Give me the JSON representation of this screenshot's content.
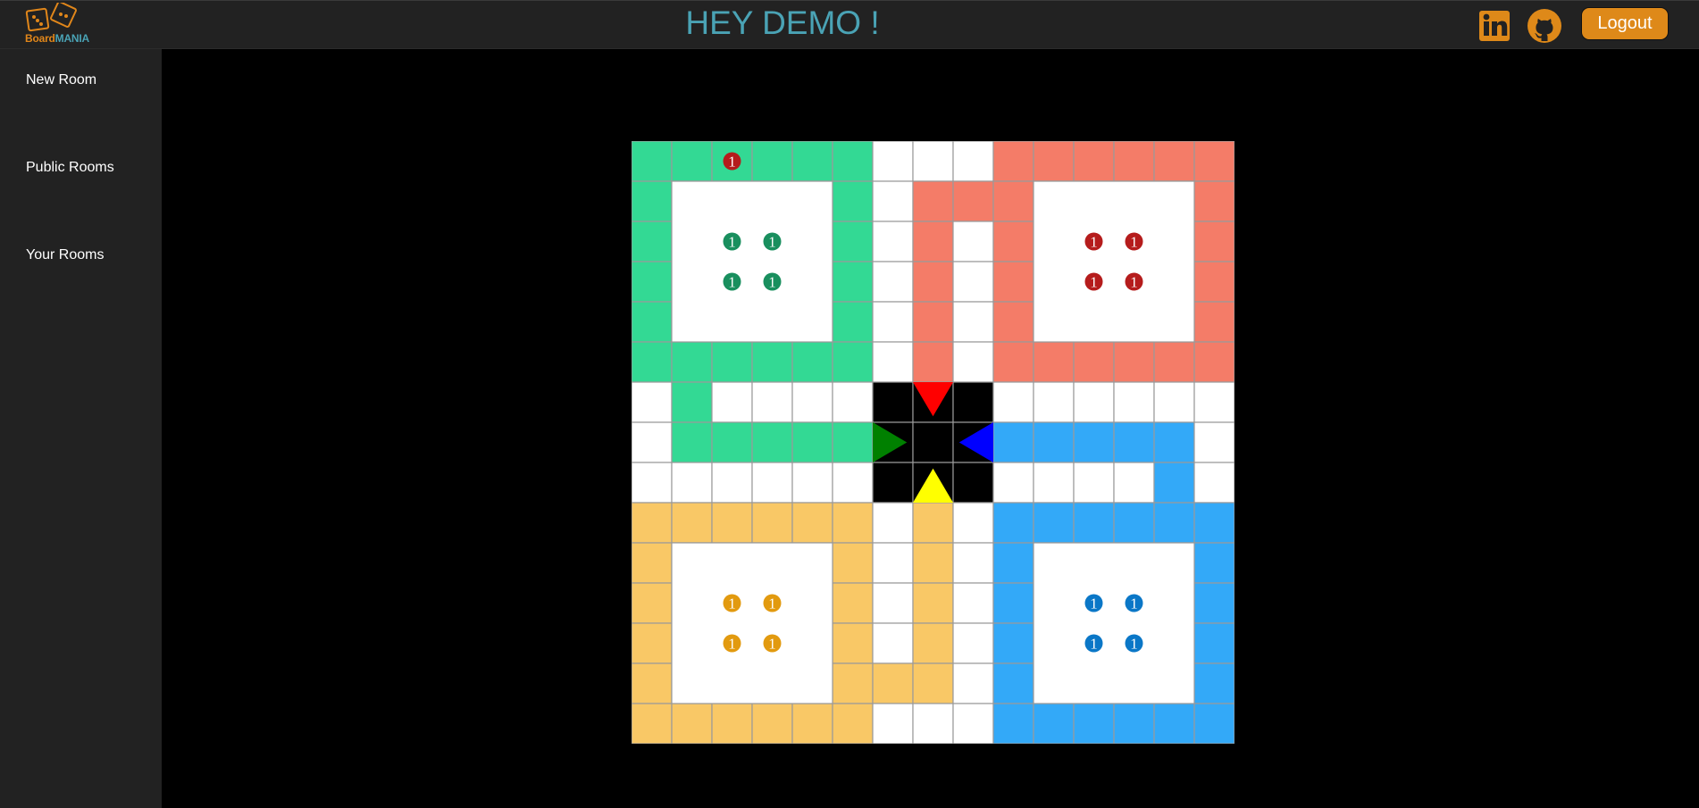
{
  "header": {
    "logo": {
      "board": "Board",
      "mania": "MANIA"
    },
    "greeting": "HEY DEMO !",
    "logout_label": "Logout",
    "icons": [
      "linkedin-icon",
      "github-icon",
      "dice-logo-icon"
    ]
  },
  "sidebar": {
    "items": [
      {
        "label": "New Room"
      },
      {
        "label": "Public Rooms"
      },
      {
        "label": "Your Rooms"
      }
    ]
  },
  "colors": {
    "green": "#33d994",
    "red": "#f47c68",
    "yellow": "#f9c866",
    "blue": "#33a9f8",
    "white": "#ffffff",
    "center": "#000000",
    "arrow_red": "#ff0000",
    "arrow_green": "#008000",
    "arrow_blue": "#0000ff",
    "arrow_yellow": "#ffff00",
    "token_green": "#198f5e",
    "token_red": "#b51c1c",
    "token_yellow": "#e29a0f",
    "token_blue": "#0a77c7"
  },
  "game": {
    "board_size": 15,
    "token_label": "1",
    "tokens": [
      {
        "player": "red",
        "row": 0,
        "col": 2,
        "label": "1"
      },
      {
        "player": "green",
        "row": 2,
        "col": 2,
        "label": "1"
      },
      {
        "player": "green",
        "row": 2,
        "col": 3,
        "label": "1"
      },
      {
        "player": "green",
        "row": 3,
        "col": 2,
        "label": "1"
      },
      {
        "player": "green",
        "row": 3,
        "col": 3,
        "label": "1"
      },
      {
        "player": "red",
        "row": 2,
        "col": 11,
        "label": "1"
      },
      {
        "player": "red",
        "row": 2,
        "col": 12,
        "label": "1"
      },
      {
        "player": "red",
        "row": 3,
        "col": 11,
        "label": "1"
      },
      {
        "player": "red",
        "row": 3,
        "col": 12,
        "label": "1"
      },
      {
        "player": "yellow",
        "row": 11,
        "col": 2,
        "label": "1"
      },
      {
        "player": "yellow",
        "row": 11,
        "col": 3,
        "label": "1"
      },
      {
        "player": "yellow",
        "row": 12,
        "col": 2,
        "label": "1"
      },
      {
        "player": "yellow",
        "row": 12,
        "col": 3,
        "label": "1"
      },
      {
        "player": "blue",
        "row": 11,
        "col": 11,
        "label": "1"
      },
      {
        "player": "blue",
        "row": 11,
        "col": 12,
        "label": "1"
      },
      {
        "player": "blue",
        "row": 12,
        "col": 11,
        "label": "1"
      },
      {
        "player": "blue",
        "row": 12,
        "col": 12,
        "label": "1"
      }
    ]
  }
}
